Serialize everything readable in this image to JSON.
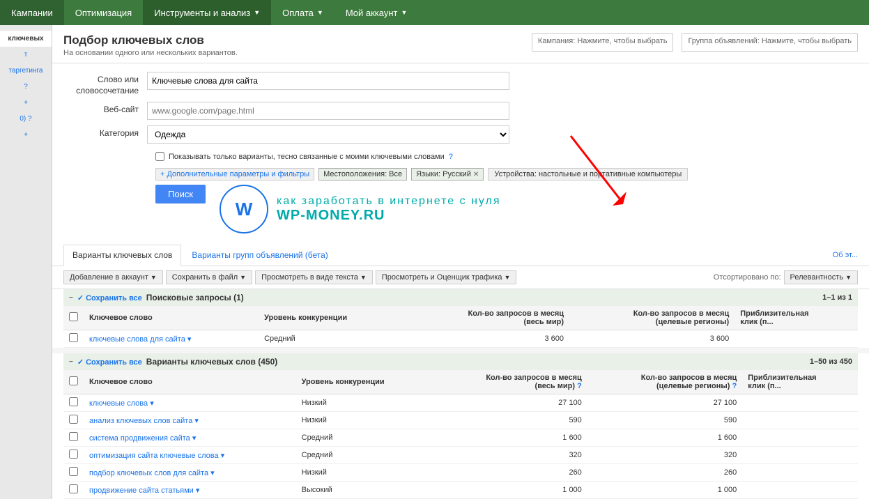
{
  "nav": {
    "items": [
      {
        "label": "Кампании",
        "active": false
      },
      {
        "label": "Оптимизация",
        "active": false
      },
      {
        "label": "Инструменты и анализ",
        "hasArrow": true,
        "active": true
      },
      {
        "label": "Оплата",
        "hasArrow": true,
        "active": false
      },
      {
        "label": "Мой аккаунт",
        "hasArrow": true,
        "active": false
      }
    ]
  },
  "sidebar": {
    "items": [
      {
        "label": "ключевых",
        "active": true
      },
      {
        "label": "т",
        "active": false
      },
      {
        "label": "таргетинга",
        "active": false
      },
      {
        "label": "?",
        "active": false
      },
      {
        "label": "+",
        "active": false
      },
      {
        "label": "0) ?",
        "active": false
      },
      {
        "label": "+",
        "active": false
      }
    ]
  },
  "page": {
    "title": "Подбор ключевых слов",
    "subtitle": "На основании одного или нескольких вариантов.",
    "about_link": "Об эт..."
  },
  "campaign_selectors": {
    "campaign_label": "Кампания: Нажмите, чтобы выбрать",
    "adgroup_label": "Группа объявлений: Нажмите, чтобы выбрать"
  },
  "form": {
    "word_label": "Слово или\nсловосочетание",
    "word_value": "Ключевые слова для сайта",
    "website_label": "Веб-сайт",
    "website_placeholder": "www.google.com/page.html",
    "category_label": "Категория",
    "category_value": "Одежда",
    "checkbox_label": "Показывать только варианты, тесно связанные с моими ключевыми словами",
    "expand_btn": "+ Дополнительные параметры и фильтры",
    "tag_location": "Местоположения: Все",
    "tag_language": "Языки: Русский",
    "tag_devices": "Устройства: настольные и портативные компьютеры",
    "search_btn": "Поиск"
  },
  "watermark": {
    "line1": "как заработать в интернете с нуля",
    "line2": "WP-MONEY.RU"
  },
  "tabs": {
    "tab1": "Варианты ключевых слов",
    "tab2": "Варианты групп объявлений (бета)",
    "about": "Об эт..."
  },
  "toolbar": {
    "add_btn": "Добавление в аккаунт",
    "save_btn": "Сохранить в файл",
    "view_text_btn": "Просмотреть в виде текста",
    "view_traffic_btn": "Просмотреть и Оценщик трафика",
    "sort_label": "Отсортировано по:",
    "sort_value": "Релевантность"
  },
  "search_queries": {
    "section_title": "Поисковые запросы (1)",
    "save_all": "✓ Сохранить все",
    "pagination": "1–1 из 1",
    "columns": [
      {
        "label": "Ключевое слово"
      },
      {
        "label": "Уровень конкуренции"
      },
      {
        "label": "Кол-во запросов в месяц\n(весь мир)"
      },
      {
        "label": "Кол-во запросов в месяц\n(целевые регионы)"
      },
      {
        "label": "Приблизительная\nклик (п..."
      }
    ],
    "rows": [
      {
        "keyword": "ключевые слова для сайта",
        "competition": "Средний",
        "world": "3 600",
        "regions": "3 600",
        "cpc": ""
      }
    ]
  },
  "keyword_variants": {
    "section_title": "Варианты ключевых слов (450)",
    "save_all": "✓ Сохранить все",
    "pagination": "1–50 из 450",
    "columns": [
      {
        "label": "Ключевое слово"
      },
      {
        "label": "Уровень конкуренции"
      },
      {
        "label": "Кол-во запросов в месяц\n(весь мир)"
      },
      {
        "label": "Кол-во запросов в месяц\n(целевые регионы)"
      },
      {
        "label": "Приблизительная\nклик (п..."
      }
    ],
    "rows": [
      {
        "keyword": "ключевые слова",
        "competition": "Низкий",
        "world": "27 100",
        "regions": "27 100",
        "cpc": ""
      },
      {
        "keyword": "анализ ключевых слов сайта",
        "competition": "Низкий",
        "world": "590",
        "regions": "590",
        "cpc": ""
      },
      {
        "keyword": "система продвижения сайта",
        "competition": "Средний",
        "world": "1 600",
        "regions": "1 600",
        "cpc": ""
      },
      {
        "keyword": "оптимизация сайта ключевые слова",
        "competition": "Средний",
        "world": "320",
        "regions": "320",
        "cpc": ""
      },
      {
        "keyword": "подбор ключевых слов для сайта",
        "competition": "Низкий",
        "world": "260",
        "regions": "260",
        "cpc": ""
      },
      {
        "keyword": "продвижение сайта статьями",
        "competition": "Высокий",
        "world": "1 000",
        "regions": "1 000",
        "cpc": ""
      }
    ]
  }
}
